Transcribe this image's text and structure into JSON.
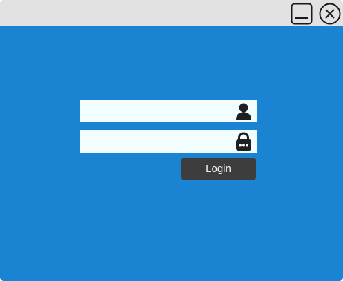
{
  "window": {
    "titlebar_color": "#e2e2e2",
    "background_color": "#1a84d2",
    "buttons": [
      {
        "name": "minimize",
        "icon": "minimize-icon"
      },
      {
        "name": "close",
        "icon": "close-circle-icon"
      }
    ]
  },
  "login_form": {
    "username": {
      "value": "",
      "placeholder": "",
      "icon": "user-icon"
    },
    "password": {
      "value": "",
      "placeholder": "",
      "icon": "lock-icon"
    },
    "submit_label": "Login",
    "button_color": "#3d3d3d",
    "field_color": "#f2fdff"
  }
}
